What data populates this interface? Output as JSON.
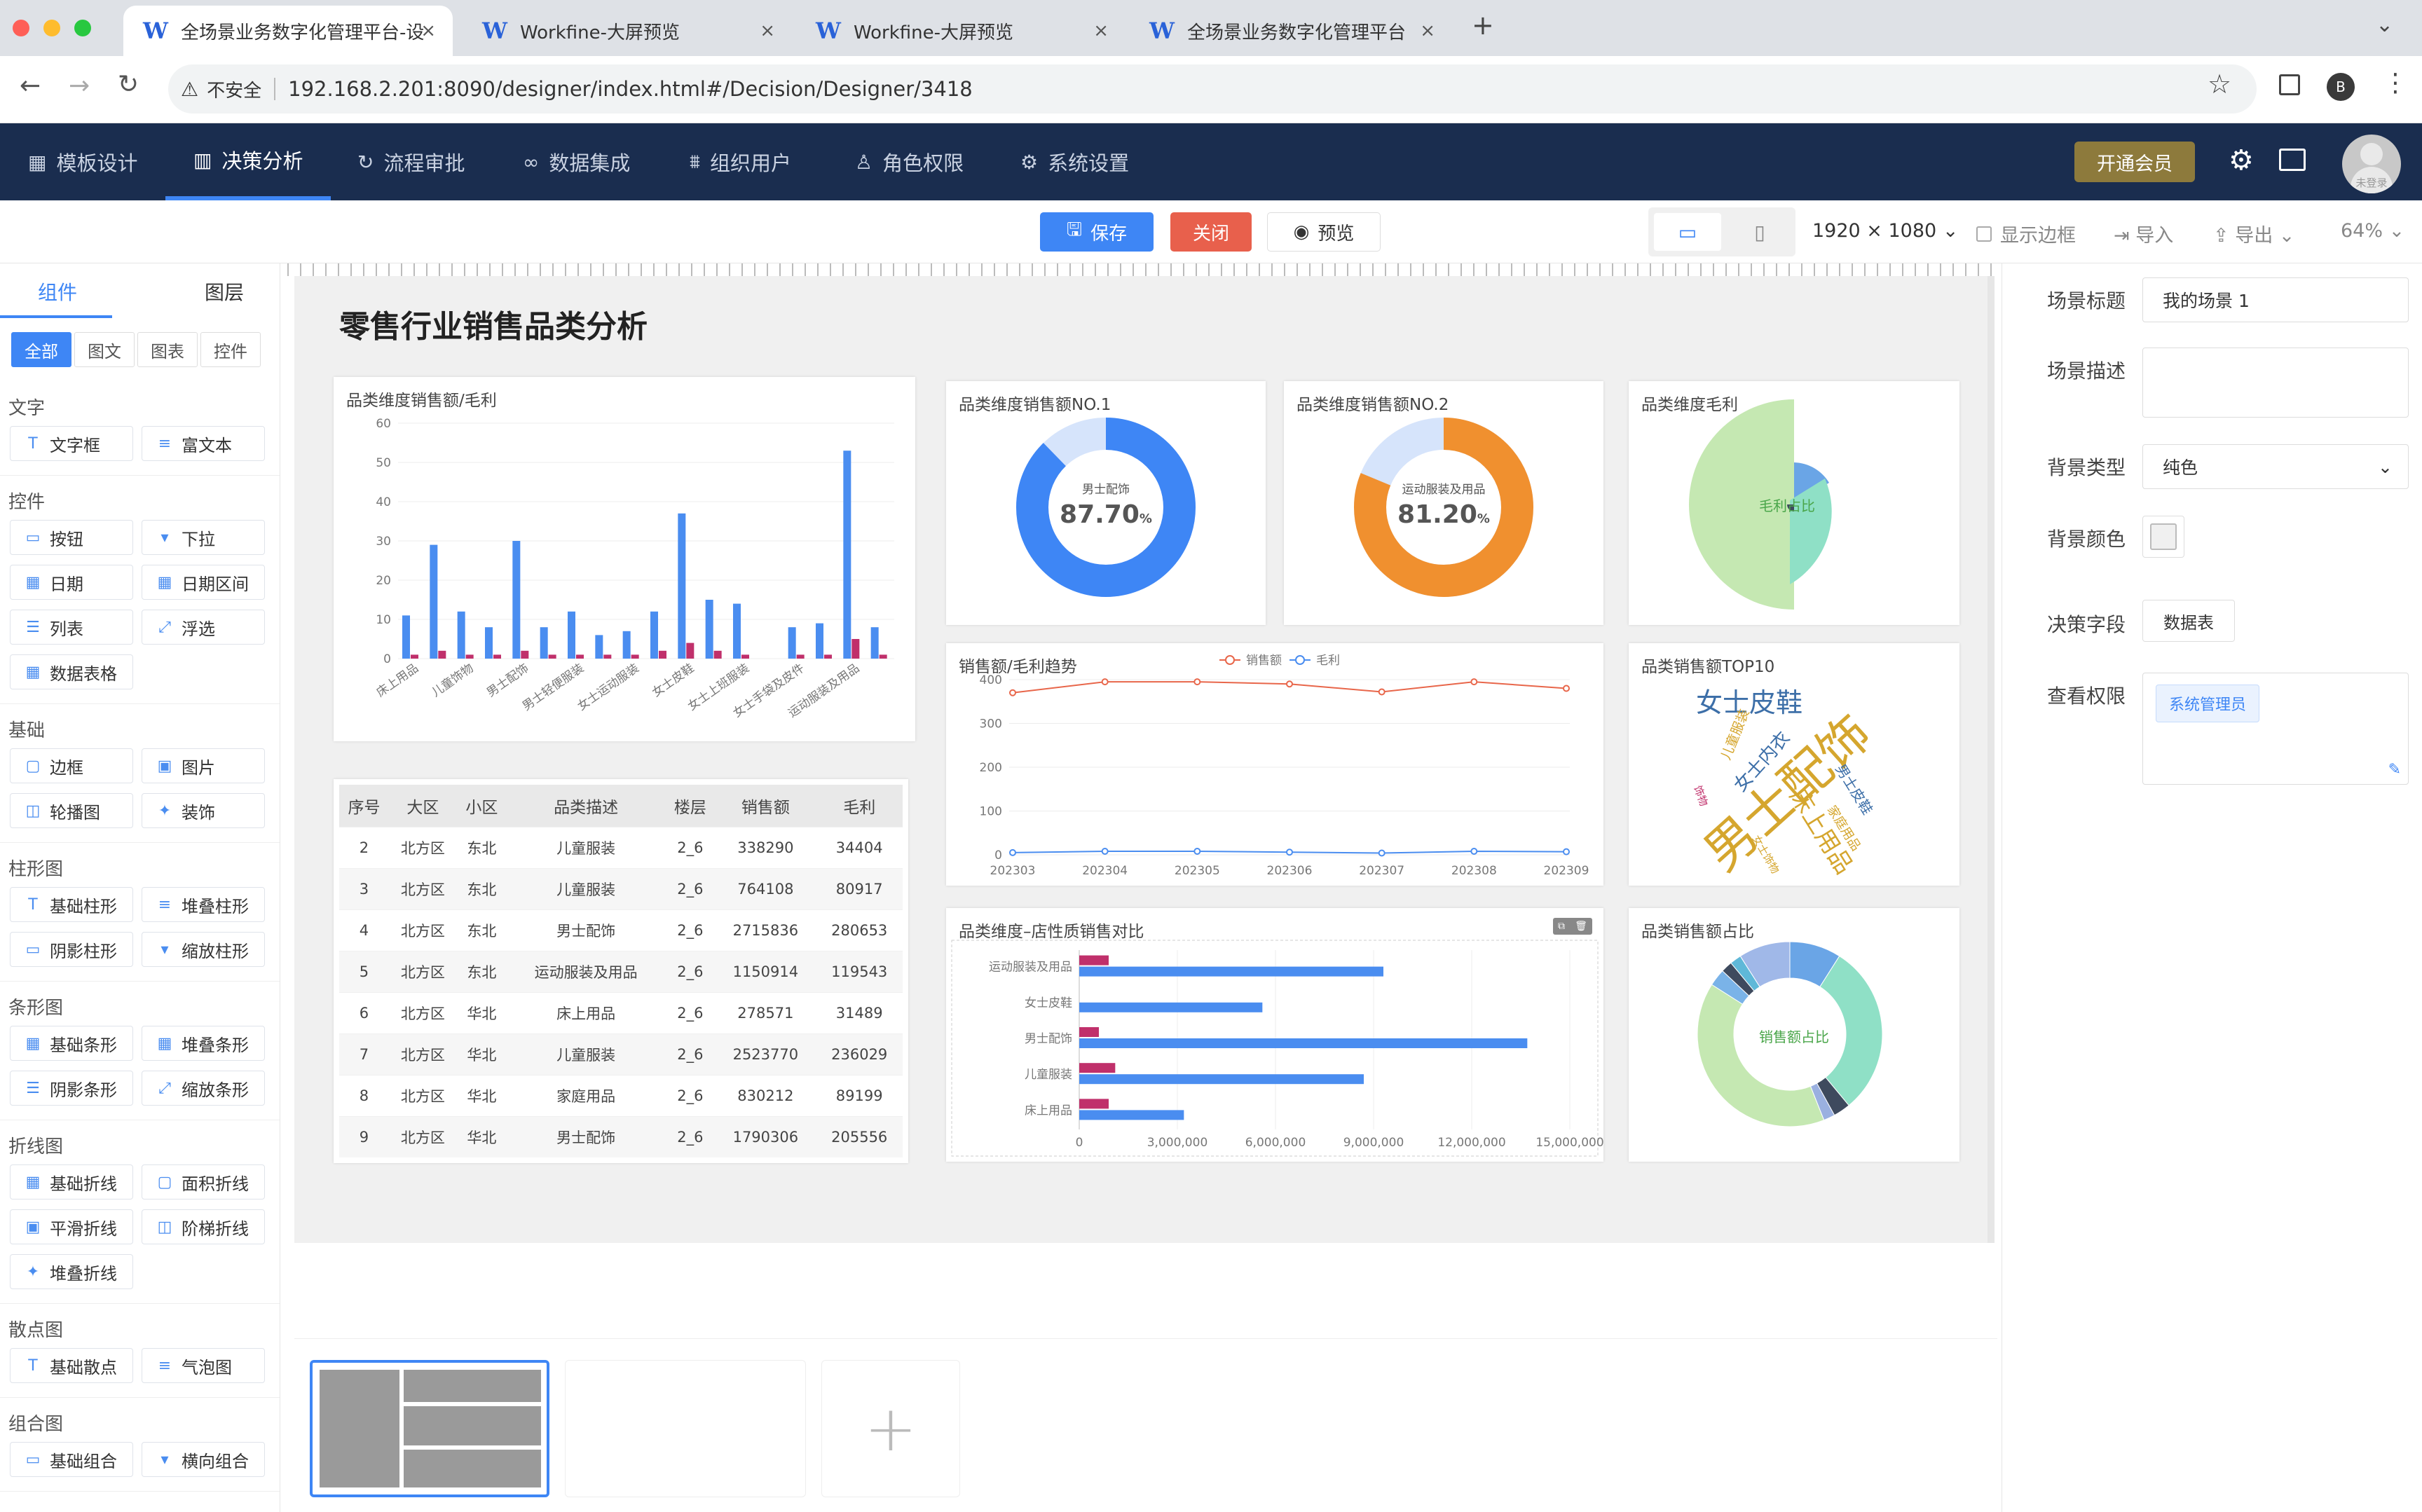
{
  "browser": {
    "tabs": [
      {
        "icon": "W",
        "label": "全场景业务数字化管理平台-设"
      },
      {
        "icon": "W",
        "label": "Workfine-大屏预览"
      },
      {
        "icon": "W",
        "label": "Workfine-大屏预览"
      },
      {
        "icon": "W",
        "label": "全场景业务数字化管理平台"
      }
    ],
    "close_glyph": "×",
    "new_tab": "+",
    "insecure": "不安全",
    "url": "192.168.2.201:8090/designer/index.html#/Decision/Designer/3418",
    "profile": "B"
  },
  "nav": {
    "items": [
      {
        "label": "模板设计"
      },
      {
        "label": "决策分析"
      },
      {
        "label": "流程审批"
      },
      {
        "label": "数据集成"
      },
      {
        "label": "组织用户"
      },
      {
        "label": "角色权限"
      },
      {
        "label": "系统设置"
      }
    ],
    "vip": "开通会员",
    "avatar_label": "未登录"
  },
  "toolbar": {
    "save": "保存",
    "close": "关闭",
    "preview": "预览",
    "resolution": "1920 × 1080",
    "show_border": "显示边框",
    "import": "导入",
    "export": "导出",
    "zoom": "64%"
  },
  "left": {
    "tabs": [
      "组件",
      "图层"
    ],
    "filters": [
      "全部",
      "图文",
      "图表",
      "控件"
    ],
    "sections": [
      {
        "title": "文字",
        "items": [
          "文字框",
          "富文本"
        ]
      },
      {
        "title": "控件",
        "items": [
          "按钮",
          "下拉",
          "日期",
          "日期区间",
          "列表",
          "浮选",
          "数据表格"
        ]
      },
      {
        "title": "基础",
        "items": [
          "边框",
          "图片",
          "轮播图",
          "装饰"
        ]
      },
      {
        "title": "柱形图",
        "items": [
          "基础柱形",
          "堆叠柱形",
          "阴影柱形",
          "缩放柱形"
        ]
      },
      {
        "title": "条形图",
        "items": [
          "基础条形",
          "堆叠条形",
          "阴影条形",
          "缩放条形"
        ]
      },
      {
        "title": "折线图",
        "items": [
          "基础折线",
          "面积折线",
          "平滑折线",
          "阶梯折线",
          "堆叠折线"
        ]
      },
      {
        "title": "散点图",
        "items": [
          "基础散点",
          "气泡图"
        ]
      },
      {
        "title": "组合图",
        "items": [
          "基础组合",
          "横向组合"
        ]
      }
    ]
  },
  "canvas": {
    "title": "零售行业销售品类分析"
  },
  "bar_chart": {
    "title": "品类维度销售额/毛利",
    "yticks": [
      "60",
      "50",
      "40",
      "30",
      "20",
      "10",
      "0"
    ],
    "categories": [
      "床上用品",
      "儿童饰物",
      "男士配饰",
      "男士轻便服装",
      "女士运动服装",
      "女士皮鞋",
      "女士上班服装",
      "女士手袋及皮件",
      "运动服装及用品"
    ],
    "series": [
      {
        "color": "#4a8df0",
        "values": [
          11,
          29,
          12,
          8,
          30,
          8,
          12,
          6,
          7,
          12,
          37,
          15,
          14,
          0,
          8,
          9,
          53,
          8
        ]
      },
      {
        "color": "#c0306b",
        "values": [
          1,
          2,
          1,
          1,
          2,
          1,
          1,
          1,
          1,
          2,
          4,
          2,
          1,
          0,
          1,
          1,
          5,
          1
        ]
      }
    ]
  },
  "donut1": {
    "title": "品类维度销售额NO.1",
    "label": "男士配饰",
    "value": "87.70",
    "unit": "%",
    "pct": 87.7,
    "color": "#3e86f5",
    "rest": "#d6e4fb"
  },
  "donut2": {
    "title": "品类维度销售额NO.2",
    "label": "运动服装及用品",
    "value": "81.20",
    "unit": "%",
    "pct": 81.2,
    "color": "#f0902f",
    "rest": "#d6e4fb"
  },
  "rose": {
    "title": "品类维度毛利",
    "center": "毛利占比"
  },
  "line_chart": {
    "title": "销售额/毛利趋势",
    "legend": [
      "销售额",
      "毛利"
    ],
    "yticks": [
      "400",
      "300",
      "200",
      "100",
      "0"
    ],
    "x": [
      "202303",
      "202304",
      "202305",
      "202306",
      "202307",
      "202308",
      "202309"
    ],
    "series": [
      {
        "name": "销售额",
        "color": "#e8664a",
        "values": [
          370,
          395,
          395,
          390,
          372,
          395,
          380
        ]
      },
      {
        "name": "毛利",
        "color": "#4a8df0",
        "values": [
          5,
          8,
          8,
          6,
          4,
          8,
          7
        ]
      }
    ]
  },
  "wordcloud": {
    "title": "品类销售额TOP10",
    "words": [
      {
        "text": "男士配饰",
        "color": "#d5a62e"
      },
      {
        "text": "女士皮鞋",
        "color": "#3d6fa8"
      },
      {
        "text": "床上用品",
        "color": "#d5a62e"
      },
      {
        "text": "女士内衣",
        "color": "#3d6fa8"
      },
      {
        "text": "男士皮鞋",
        "color": "#3d6fa8"
      },
      {
        "text": "儿童服装",
        "color": "#d5a62e"
      },
      {
        "text": "家庭用品",
        "color": "#d5a62e"
      },
      {
        "text": "女士饰物",
        "color": "#d5a62e"
      },
      {
        "text": "饰物",
        "color": "#c0306b"
      }
    ]
  },
  "table": {
    "headers": [
      "序号",
      "大区",
      "小区",
      "品类描述",
      "楼层",
      "销售额",
      "毛利"
    ],
    "rows": [
      [
        "2",
        "北方区",
        "东北",
        "儿童服装",
        "2_6",
        "338290",
        "34404"
      ],
      [
        "3",
        "北方区",
        "东北",
        "儿童服装",
        "2_6",
        "764108",
        "80917"
      ],
      [
        "4",
        "北方区",
        "东北",
        "男士配饰",
        "2_6",
        "2715836",
        "280653"
      ],
      [
        "5",
        "北方区",
        "东北",
        "运动服装及用品",
        "2_6",
        "1150914",
        "119543"
      ],
      [
        "6",
        "北方区",
        "华北",
        "床上用品",
        "2_6",
        "278571",
        "31489"
      ],
      [
        "7",
        "北方区",
        "华北",
        "儿童服装",
        "2_6",
        "2523770",
        "236029"
      ],
      [
        "8",
        "北方区",
        "华北",
        "家庭用品",
        "2_6",
        "830212",
        "89199"
      ],
      [
        "9",
        "北方区",
        "华北",
        "男士配饰",
        "2_6",
        "1790306",
        "205556"
      ]
    ]
  },
  "hbar": {
    "title": "品类维度–店性质销售对比",
    "categories": [
      "运动服装及用品",
      "女士皮鞋",
      "男士配饰",
      "儿童服装",
      "床上用品"
    ],
    "xticks": [
      "0",
      "3,000,000",
      "6,000,000",
      "9,000,000",
      "12,000,000",
      "15,000,000"
    ],
    "series": [
      {
        "color": "#4a8df0",
        "values": [
          9300000,
          5600000,
          13700000,
          8700000,
          3200000
        ]
      },
      {
        "color": "#c0306b",
        "values": [
          900000,
          0,
          600000,
          1100000,
          900000
        ]
      }
    ]
  },
  "pie2": {
    "title": "品类销售额占比",
    "center": "销售额占比",
    "slices": [
      {
        "value": 9,
        "color": "#6aa5e6"
      },
      {
        "value": 30,
        "color": "#8fe0c6"
      },
      {
        "value": 3,
        "color": "#3e4a5e"
      },
      {
        "value": 2,
        "color": "#9ab0e0"
      },
      {
        "value": 40,
        "color": "#c5e8b2"
      },
      {
        "value": 3,
        "color": "#7ab3e8"
      },
      {
        "value": 2,
        "color": "#3e4a5e"
      },
      {
        "value": 2,
        "color": "#5fb8d8"
      },
      {
        "value": 9,
        "color": "#a0b8e8"
      }
    ]
  },
  "right": {
    "scene_title_label": "场景标题",
    "scene_title": "我的场景 1",
    "scene_desc_label": "场景描述",
    "bg_type_label": "背景类型",
    "bg_type": "纯色",
    "bg_color_label": "背景颜色",
    "field_label": "决策字段",
    "field_btn": "数据表",
    "perm_label": "查看权限",
    "perm_tag": "系统管理员"
  },
  "colors": {
    "nav_bg": "#1a2d4f",
    "accent": "#3e86f5",
    "close_btn": "#e8604c",
    "vip": "#8d7a3c"
  }
}
